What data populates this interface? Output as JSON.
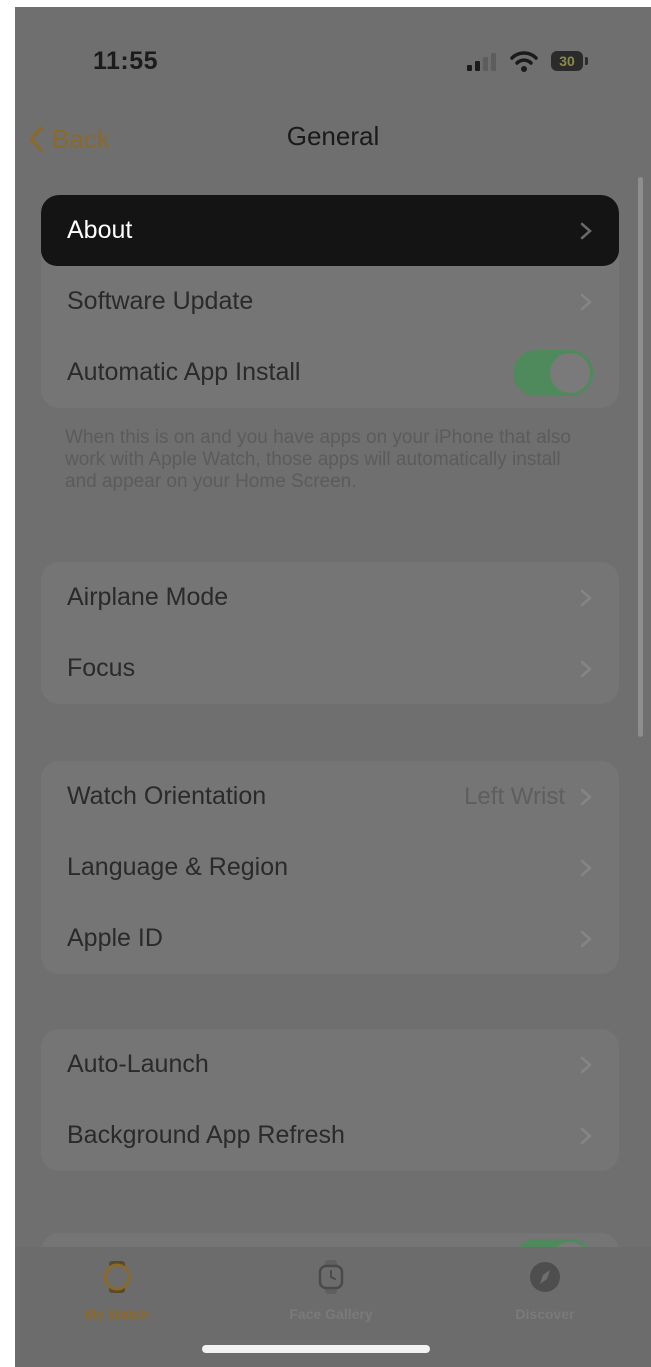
{
  "status": {
    "time": "11:55",
    "battery": "30"
  },
  "nav": {
    "back_label": "Back",
    "title": "General"
  },
  "group1": {
    "about": "About",
    "software_update": "Software Update",
    "auto_install": "Automatic App Install",
    "auto_install_on": true,
    "footnote": "When this is on and you have apps on your iPhone that also work with Apple Watch, those apps will automatically install and appear on your Home Screen."
  },
  "group2": {
    "airplane": "Airplane Mode",
    "focus": "Focus"
  },
  "group3": {
    "orientation": "Watch Orientation",
    "orientation_value": "Left Wrist",
    "language": "Language & Region",
    "apple_id": "Apple ID"
  },
  "group4": {
    "auto_launch": "Auto-Launch",
    "background_refresh": "Background App Refresh"
  },
  "tabs": [
    {
      "label": "My Watch",
      "icon": "watch-icon",
      "active": true
    },
    {
      "label": "Face Gallery",
      "icon": "watch-face-icon",
      "active": false
    },
    {
      "label": "Discover",
      "icon": "compass-icon",
      "active": false
    }
  ],
  "colors": {
    "accent": "#8a6a2c",
    "toggle_on": "#4f8a5c",
    "selected_row": "#141414"
  }
}
